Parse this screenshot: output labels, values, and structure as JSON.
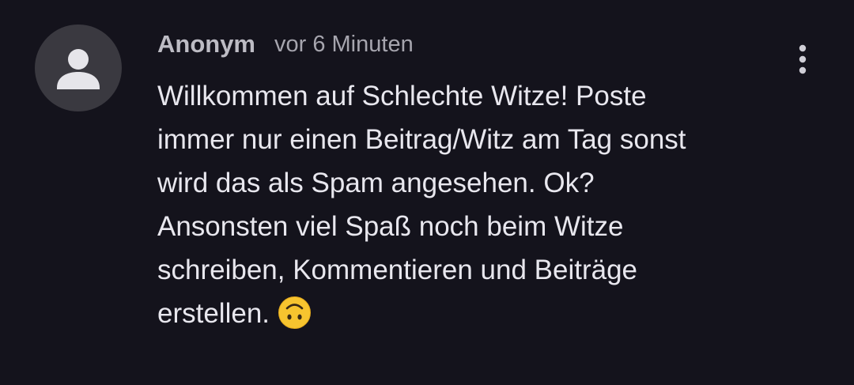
{
  "comment": {
    "author": "Anonym",
    "time": "vor 6 Minuten",
    "text": "Willkommen auf Schlechte Witze! Poste\nimmer nur einen Beitrag/Witz am Tag sonst\nwird das als Spam angesehen. Ok?\nAnsonsten viel Spaß noch beim Witze\nschreiben, Kommentieren und Beiträge\nerstellen.",
    "emoji": "upside-down-face-emoji"
  },
  "icons": {
    "avatar": "person-icon",
    "menu": "more-vert-icon"
  },
  "colors": {
    "background": "#14131c",
    "avatar_bg": "#3a3940",
    "avatar_fg": "#e6e5ea",
    "text": "#e8e7ee",
    "muted": "#a6a5ae"
  }
}
